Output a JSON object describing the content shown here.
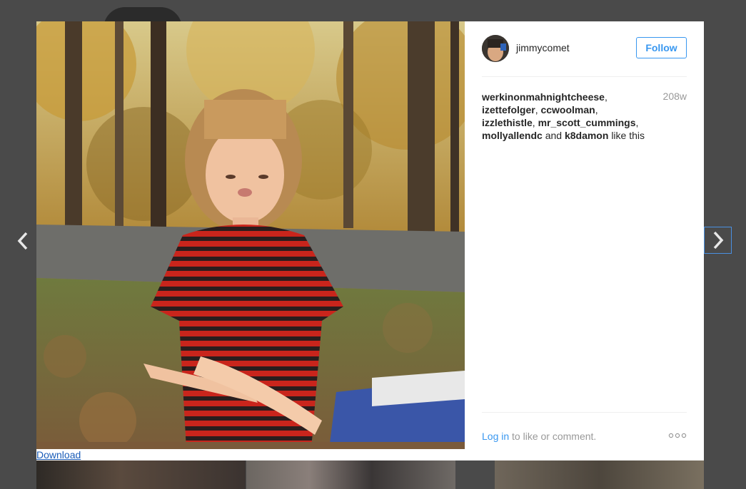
{
  "post": {
    "username": "jimmycomet",
    "follow_label": "Follow",
    "age": "208w",
    "likers": [
      "werkinonmahnightcheese",
      "izettefolger",
      "ccwoolman",
      "izzlethistle",
      "mr_scott_cummings",
      "mollyallendc",
      "k8damon"
    ],
    "likes_and": "and",
    "likes_suffix": "like this",
    "login_link": "Log in",
    "login_suffix": "to like or comment.",
    "more_label": "ooo",
    "download_label": "Download"
  },
  "colors": {
    "link": "#3897f0",
    "text": "#262626",
    "muted": "#999999"
  },
  "icons": {
    "prev": "chevron-left-icon",
    "next": "chevron-right-icon"
  }
}
